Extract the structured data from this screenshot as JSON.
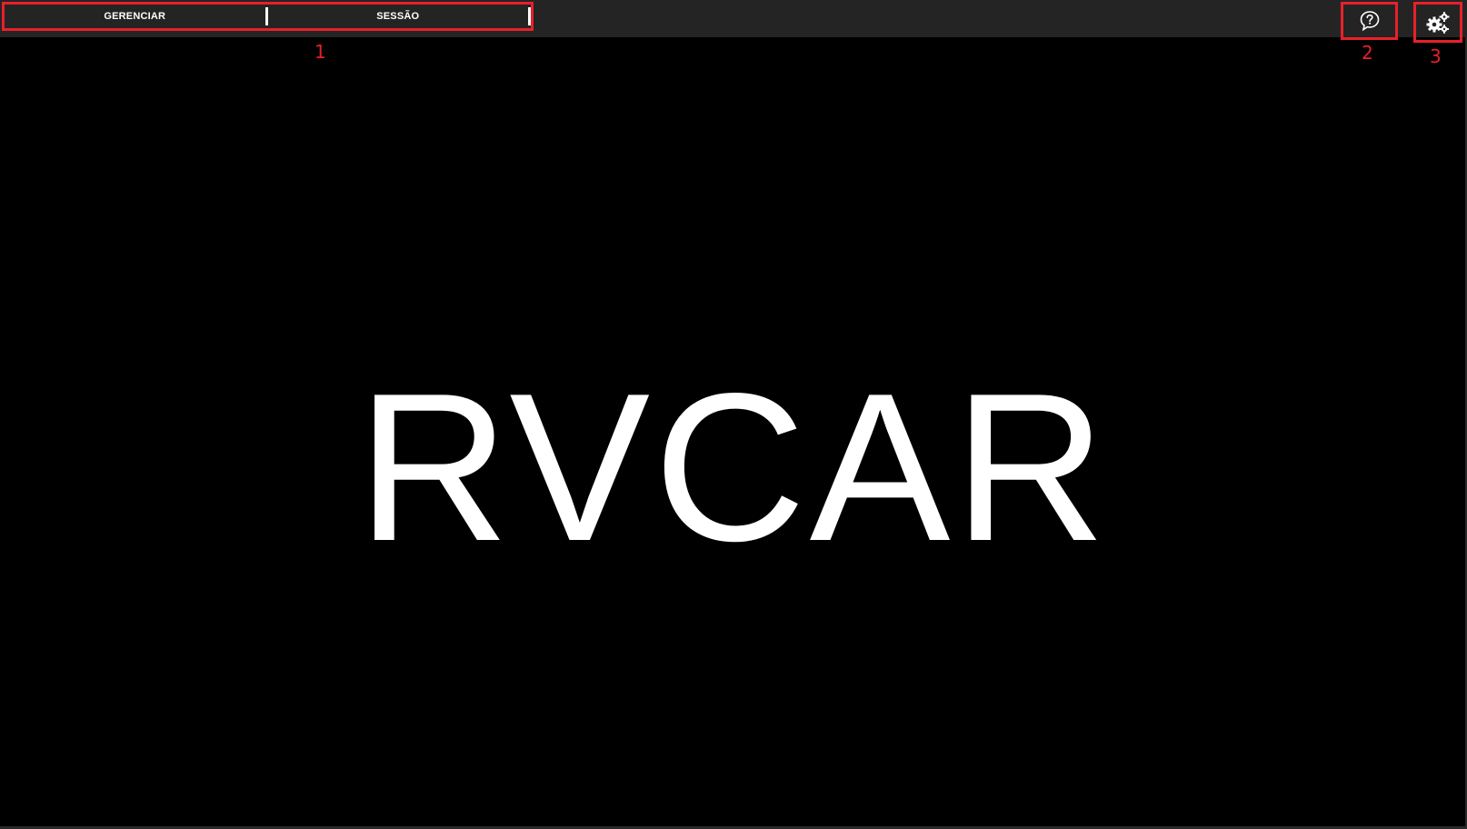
{
  "toolbar": {
    "menu": [
      {
        "label": "GERENCIAR"
      },
      {
        "label": "SESSÃO"
      }
    ],
    "help_icon": "help-bubble-icon",
    "settings_icon": "gears-icon"
  },
  "annotations": {
    "menu": "1",
    "help": "2",
    "settings": "3"
  },
  "main": {
    "logo_text": "RVCAR"
  },
  "colors": {
    "topbar": "#242424",
    "background": "#000000",
    "highlight": "#e8202a",
    "text": "#ffffff"
  }
}
